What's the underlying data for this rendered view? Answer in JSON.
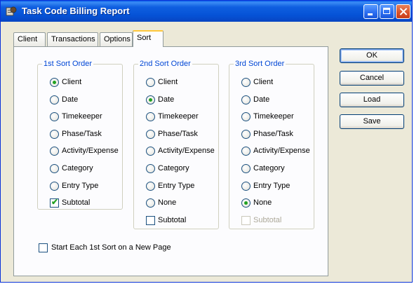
{
  "window": {
    "title": "Task Code Billing Report"
  },
  "tabs": [
    {
      "label": "Client"
    },
    {
      "label": "Transactions"
    },
    {
      "label": "Options"
    },
    {
      "label": "Sort",
      "active": true
    }
  ],
  "groups": [
    {
      "legend": "1st Sort Order",
      "options": [
        "Client",
        "Date",
        "Timekeeper",
        "Phase/Task",
        "Activity/Expense",
        "Category",
        "Entry Type"
      ],
      "selected": "Client",
      "subtotal": {
        "label": "Subtotal",
        "checked": true,
        "enabled": true
      }
    },
    {
      "legend": "2nd Sort Order",
      "options": [
        "Client",
        "Date",
        "Timekeeper",
        "Phase/Task",
        "Activity/Expense",
        "Category",
        "Entry Type",
        "None"
      ],
      "selected": "Date",
      "subtotal": {
        "label": "Subtotal",
        "checked": false,
        "enabled": true
      }
    },
    {
      "legend": "3rd Sort Order",
      "options": [
        "Client",
        "Date",
        "Timekeeper",
        "Phase/Task",
        "Activity/Expense",
        "Category",
        "Entry Type",
        "None"
      ],
      "selected": "None",
      "subtotal": {
        "label": "Subtotal",
        "checked": false,
        "enabled": false
      }
    }
  ],
  "new_page": {
    "label": "Start Each 1st Sort on a New Page",
    "checked": false
  },
  "buttons": {
    "ok": "OK",
    "cancel": "Cancel",
    "load": "Load",
    "save": "Save"
  },
  "colors": {
    "titlebar": "#0552d6",
    "legend_text": "#0046d5",
    "radio_selected": "#21a121",
    "active_tab_accent": "#ffc83c"
  }
}
